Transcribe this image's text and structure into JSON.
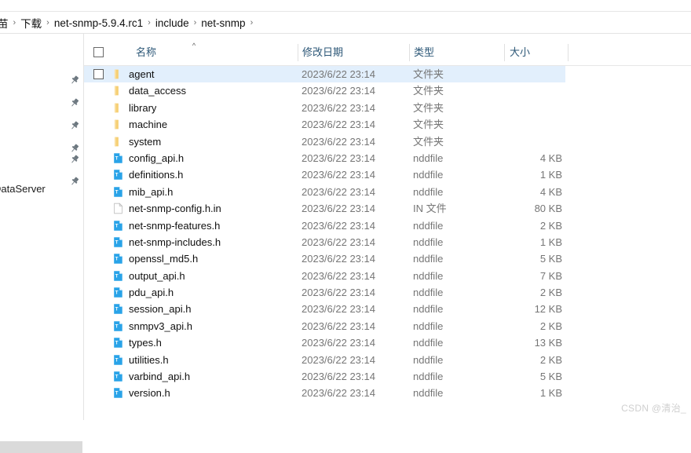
{
  "breadcrumb": {
    "segments": [
      "苗",
      "下载",
      "net-snmp-5.9.4.rc1",
      "include",
      "net-snmp"
    ],
    "separator": "›"
  },
  "nav_pane": {
    "pin_icon_name": "pin-icon",
    "pin_count": 6,
    "visible_label": "DataServer"
  },
  "columns": {
    "name": "名称",
    "date_modified": "修改日期",
    "type": "类型",
    "size": "大小",
    "sort_indicator": "^"
  },
  "rows": [
    {
      "name": "agent",
      "date": "2023/6/22 23:14",
      "type": "文件夹",
      "size": "",
      "icon": "folder-icon",
      "selected": true,
      "checkbox": true
    },
    {
      "name": "data_access",
      "date": "2023/6/22 23:14",
      "type": "文件夹",
      "size": "",
      "icon": "folder-icon",
      "selected": false,
      "checkbox": false
    },
    {
      "name": "library",
      "date": "2023/6/22 23:14",
      "type": "文件夹",
      "size": "",
      "icon": "folder-icon",
      "selected": false,
      "checkbox": false
    },
    {
      "name": "machine",
      "date": "2023/6/22 23:14",
      "type": "文件夹",
      "size": "",
      "icon": "folder-icon",
      "selected": false,
      "checkbox": false
    },
    {
      "name": "system",
      "date": "2023/6/22 23:14",
      "type": "文件夹",
      "size": "",
      "icon": "folder-icon",
      "selected": false,
      "checkbox": false
    },
    {
      "name": "config_api.h",
      "date": "2023/6/22 23:14",
      "type": "nddfile",
      "size": "4 KB",
      "icon": "text-file-icon",
      "selected": false,
      "checkbox": false
    },
    {
      "name": "definitions.h",
      "date": "2023/6/22 23:14",
      "type": "nddfile",
      "size": "1 KB",
      "icon": "text-file-icon",
      "selected": false,
      "checkbox": false
    },
    {
      "name": "mib_api.h",
      "date": "2023/6/22 23:14",
      "type": "nddfile",
      "size": "4 KB",
      "icon": "text-file-icon",
      "selected": false,
      "checkbox": false
    },
    {
      "name": "net-snmp-config.h.in",
      "date": "2023/6/22 23:14",
      "type": "IN 文件",
      "size": "80 KB",
      "icon": "blank-file-icon",
      "selected": false,
      "checkbox": false
    },
    {
      "name": "net-snmp-features.h",
      "date": "2023/6/22 23:14",
      "type": "nddfile",
      "size": "2 KB",
      "icon": "text-file-icon",
      "selected": false,
      "checkbox": false
    },
    {
      "name": "net-snmp-includes.h",
      "date": "2023/6/22 23:14",
      "type": "nddfile",
      "size": "1 KB",
      "icon": "text-file-icon",
      "selected": false,
      "checkbox": false
    },
    {
      "name": "openssl_md5.h",
      "date": "2023/6/22 23:14",
      "type": "nddfile",
      "size": "5 KB",
      "icon": "text-file-icon",
      "selected": false,
      "checkbox": false
    },
    {
      "name": "output_api.h",
      "date": "2023/6/22 23:14",
      "type": "nddfile",
      "size": "7 KB",
      "icon": "text-file-icon",
      "selected": false,
      "checkbox": false
    },
    {
      "name": "pdu_api.h",
      "date": "2023/6/22 23:14",
      "type": "nddfile",
      "size": "2 KB",
      "icon": "text-file-icon",
      "selected": false,
      "checkbox": false
    },
    {
      "name": "session_api.h",
      "date": "2023/6/22 23:14",
      "type": "nddfile",
      "size": "12 KB",
      "icon": "text-file-icon",
      "selected": false,
      "checkbox": false
    },
    {
      "name": "snmpv3_api.h",
      "date": "2023/6/22 23:14",
      "type": "nddfile",
      "size": "2 KB",
      "icon": "text-file-icon",
      "selected": false,
      "checkbox": false
    },
    {
      "name": "types.h",
      "date": "2023/6/22 23:14",
      "type": "nddfile",
      "size": "13 KB",
      "icon": "text-file-icon",
      "selected": false,
      "checkbox": false
    },
    {
      "name": "utilities.h",
      "date": "2023/6/22 23:14",
      "type": "nddfile",
      "size": "2 KB",
      "icon": "text-file-icon",
      "selected": false,
      "checkbox": false
    },
    {
      "name": "varbind_api.h",
      "date": "2023/6/22 23:14",
      "type": "nddfile",
      "size": "5 KB",
      "icon": "text-file-icon",
      "selected": false,
      "checkbox": false
    },
    {
      "name": "version.h",
      "date": "2023/6/22 23:14",
      "type": "nddfile",
      "size": "1 KB",
      "icon": "text-file-icon",
      "selected": false,
      "checkbox": false
    }
  ],
  "watermark": "CSDN @清治_",
  "colors": {
    "selection": "#e2effc",
    "header_text": "#2c5777",
    "folder_icon": "#f6cf74",
    "file_icon": "#29a3e8",
    "secondary_text": "#767676"
  }
}
